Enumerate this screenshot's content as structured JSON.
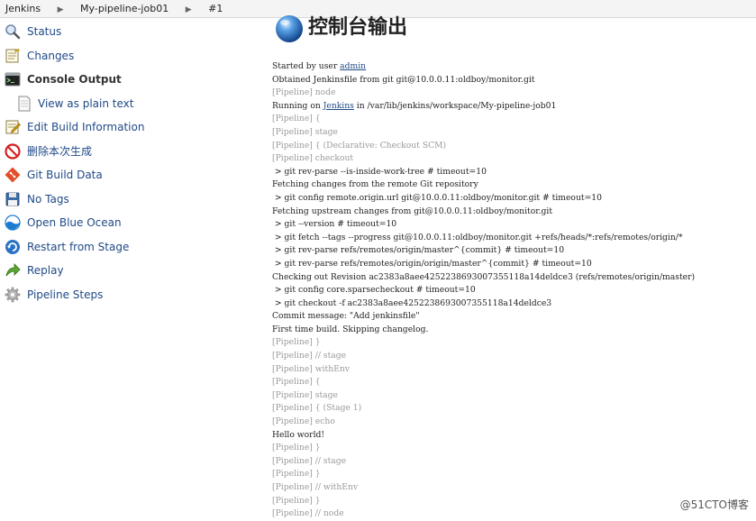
{
  "breadcrumb": {
    "items": [
      "Jenkins",
      "My-pipeline-job01",
      "#1"
    ],
    "separator": "▶"
  },
  "sidebar": {
    "items": [
      {
        "label": "Status",
        "icon": "search-icon"
      },
      {
        "label": "Changes",
        "icon": "notepad-icon"
      },
      {
        "label": "Console Output",
        "icon": "terminal-icon",
        "active": true
      },
      {
        "label": "View as plain text",
        "icon": "document-icon",
        "sub": true
      },
      {
        "label": "Edit Build Information",
        "icon": "notepad-pencil-icon"
      },
      {
        "label": "删除本次生成",
        "icon": "no-entry-icon"
      },
      {
        "label": "Git Build Data",
        "icon": "git-icon"
      },
      {
        "label": "No Tags",
        "icon": "floppy-disk-icon"
      },
      {
        "label": "Open Blue Ocean",
        "icon": "blue-ocean-icon"
      },
      {
        "label": "Restart from Stage",
        "icon": "restart-icon"
      },
      {
        "label": "Replay",
        "icon": "replay-arrow-icon"
      },
      {
        "label": "Pipeline Steps",
        "icon": "gear-icon"
      }
    ]
  },
  "main": {
    "title": "控制台输出",
    "title_icon": "blue-globe-icon"
  },
  "console": {
    "lines": [
      {
        "text": "Started by user ",
        "link": "admin"
      },
      {
        "text": "Obtained Jenkinsfile from git git@10.0.0.11:oldboy/monitor.git"
      },
      {
        "text": "[Pipeline] node",
        "pipeline": true
      },
      {
        "text": "Running on ",
        "link": "Jenkins",
        "after": " in /var/lib/jenkins/workspace/My-pipeline-job01"
      },
      {
        "text": "[Pipeline] {",
        "pipeline": true
      },
      {
        "text": "[Pipeline] stage",
        "pipeline": true
      },
      {
        "text": "[Pipeline] { (Declarative: Checkout SCM)",
        "pipeline": true
      },
      {
        "text": "[Pipeline] checkout",
        "pipeline": true
      },
      {
        "text": " > git rev-parse --is-inside-work-tree # timeout=10"
      },
      {
        "text": "Fetching changes from the remote Git repository"
      },
      {
        "text": " > git config remote.origin.url git@10.0.0.11:oldboy/monitor.git # timeout=10"
      },
      {
        "text": "Fetching upstream changes from git@10.0.0.11:oldboy/monitor.git"
      },
      {
        "text": " > git --version # timeout=10"
      },
      {
        "text": " > git fetch --tags --progress git@10.0.0.11:oldboy/monitor.git +refs/heads/*:refs/remotes/origin/*"
      },
      {
        "text": " > git rev-parse refs/remotes/origin/master^{commit} # timeout=10"
      },
      {
        "text": " > git rev-parse refs/remotes/origin/origin/master^{commit} # timeout=10"
      },
      {
        "text": "Checking out Revision ac2383a8aee4252238693007355118a14deldce3 (refs/remotes/origin/master)"
      },
      {
        "text": " > git config core.sparsecheckout # timeout=10"
      },
      {
        "text": " > git checkout -f ac2383a8aee4252238693007355118a14deldce3"
      },
      {
        "text": "Commit message: \"Add jenkinsfile\""
      },
      {
        "text": "First time build. Skipping changelog."
      },
      {
        "text": "[Pipeline] }",
        "pipeline": true
      },
      {
        "text": "[Pipeline] // stage",
        "pipeline": true
      },
      {
        "text": "[Pipeline] withEnv",
        "pipeline": true
      },
      {
        "text": "[Pipeline] {",
        "pipeline": true
      },
      {
        "text": "[Pipeline] stage",
        "pipeline": true
      },
      {
        "text": "[Pipeline] { (Stage 1)",
        "pipeline": true
      },
      {
        "text": "[Pipeline] echo",
        "pipeline": true
      },
      {
        "text": "Hello world!"
      },
      {
        "text": "[Pipeline] }",
        "pipeline": true
      },
      {
        "text": "[Pipeline] // stage",
        "pipeline": true
      },
      {
        "text": "[Pipeline] }",
        "pipeline": true
      },
      {
        "text": "[Pipeline] // withEnv",
        "pipeline": true
      },
      {
        "text": "[Pipeline] }",
        "pipeline": true
      },
      {
        "text": "[Pipeline] // node",
        "pipeline": true
      }
    ]
  },
  "watermark": "@51CTO博客"
}
